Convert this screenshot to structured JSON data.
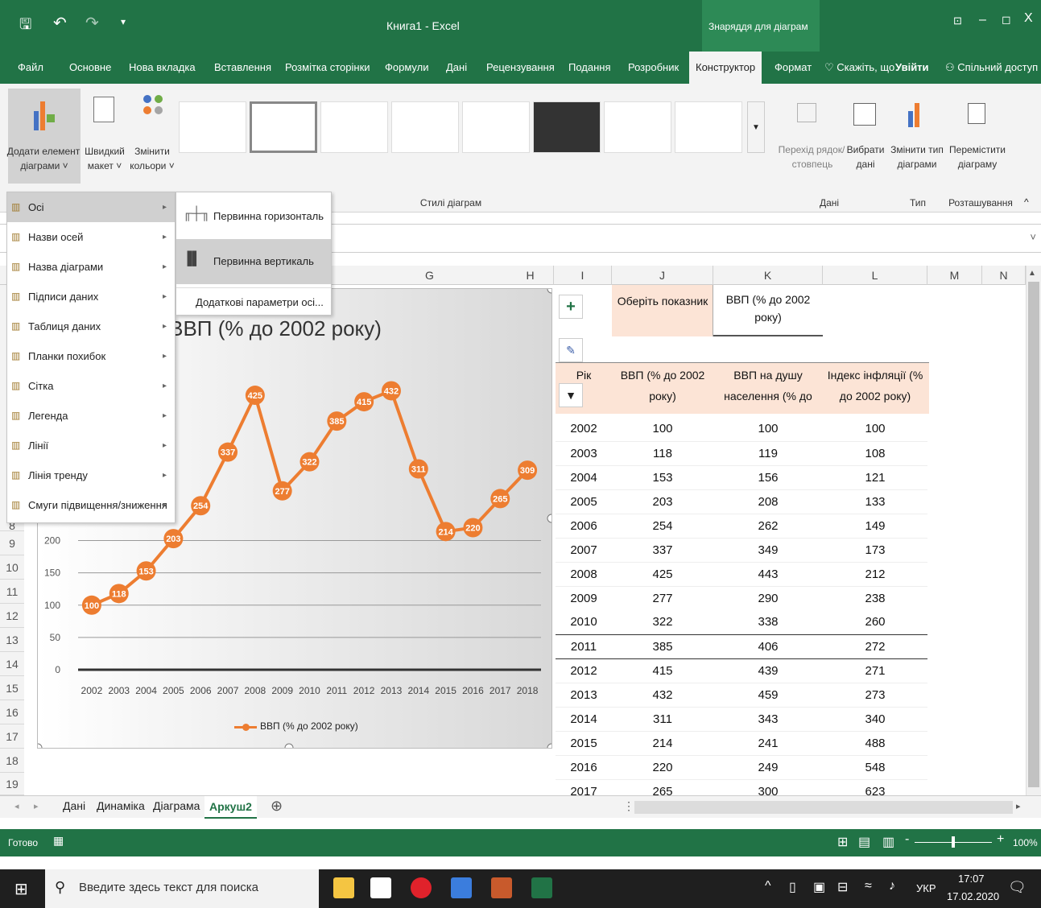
{
  "window": {
    "title": "Книга1 - Excel",
    "context_label": "Знаряддя для діаграм",
    "controls": [
      "▢",
      "–",
      "◻",
      "X"
    ]
  },
  "tabs": [
    "Файл",
    "Основне",
    "Нова вкладка",
    "Вставлення",
    "Розмітка сторінки",
    "Формули",
    "Дані",
    "Рецензування",
    "Подання",
    "Розробник",
    "Конструктор",
    "Формат"
  ],
  "tell_me": "Скажіть, що",
  "signin": "Увійти",
  "share": "Спільний доступ",
  "ribbon": {
    "add_element": [
      "Додати елемент",
      "діаграми ˅"
    ],
    "quick_layout": [
      "Швидкий",
      "макет ˅"
    ],
    "change_colors": [
      "Змінити",
      "кольори ˅"
    ],
    "styles_group": "Стилі діаграм",
    "switch_rowcol": [
      "Перехід рядок/",
      "стовпець"
    ],
    "select_data": [
      "Вибрати",
      "дані"
    ],
    "change_type": [
      "Змінити тип",
      "діаграми"
    ],
    "move_chart": [
      "Перемістити",
      "діаграму"
    ],
    "group_data": "Дані",
    "group_type": "Тип",
    "group_location": "Розташування"
  },
  "menu": {
    "items": [
      "Осі",
      "Назви осей",
      "Назва діаграми",
      "Підписи даних",
      "Таблиця даних",
      "Планки похибок",
      "Сітка",
      "Легенда",
      "Лінії",
      "Лінія тренду",
      "Смуги підвищення/зниження"
    ],
    "sub": [
      "Первинна горизонталь",
      "Первинна вертикаль",
      "Додаткові параметри осі..."
    ]
  },
  "columns": [
    "G",
    "H",
    "I",
    "J",
    "K",
    "L",
    "M",
    "N"
  ],
  "rows": [
    "8",
    "9",
    "10",
    "11",
    "12",
    "13",
    "14",
    "15",
    "16",
    "17",
    "18",
    "19"
  ],
  "sheet": {
    "select_label": "Оберіть показник",
    "select_value": [
      "ВВП (% до 2002",
      "року)"
    ],
    "headers": [
      [
        "Рік"
      ],
      [
        "ВВП (% до 2002",
        "року)"
      ],
      [
        "ВВП на душу",
        "населення (% до"
      ],
      [
        "Індекс інфляції (%",
        "до 2002 року)"
      ]
    ],
    "table": [
      [
        "2002",
        "100",
        "100",
        "100"
      ],
      [
        "2003",
        "118",
        "119",
        "108"
      ],
      [
        "2004",
        "153",
        "156",
        "121"
      ],
      [
        "2005",
        "203",
        "208",
        "133"
      ],
      [
        "2006",
        "254",
        "262",
        "149"
      ],
      [
        "2007",
        "337",
        "349",
        "173"
      ],
      [
        "2008",
        "425",
        "443",
        "212"
      ],
      [
        "2009",
        "277",
        "290",
        "238"
      ],
      [
        "2010",
        "322",
        "338",
        "260"
      ],
      [
        "2011",
        "385",
        "406",
        "272"
      ],
      [
        "2012",
        "415",
        "439",
        "271"
      ],
      [
        "2013",
        "432",
        "459",
        "273"
      ],
      [
        "2014",
        "311",
        "343",
        "340"
      ],
      [
        "2015",
        "214",
        "241",
        "488"
      ],
      [
        "2016",
        "220",
        "249",
        "548"
      ],
      [
        "2017",
        "265",
        "300",
        "623"
      ]
    ]
  },
  "chart_data": {
    "type": "line",
    "title": "ВВП (% до 2002 року)",
    "x": [
      "2002",
      "2003",
      "2004",
      "2005",
      "2006",
      "2007",
      "2008",
      "2009",
      "2010",
      "2011",
      "2012",
      "2013",
      "2014",
      "2015",
      "2016",
      "2017",
      "2018"
    ],
    "series": [
      {
        "name": "ВВП (% до 2002 року)",
        "values": [
          100,
          118,
          153,
          203,
          254,
          337,
          425,
          277,
          322,
          385,
          415,
          432,
          311,
          214,
          220,
          265,
          309
        ]
      }
    ],
    "yticks": [
      "0",
      "50",
      "100",
      "150",
      "200"
    ],
    "ylim": [
      0,
      450
    ],
    "color": "#ed7d31",
    "legend": "bottom",
    "grid": true
  },
  "sheet_tabs": [
    "Дані",
    "Динаміка",
    "Діаграма",
    "Аркуш2"
  ],
  "status": {
    "ready": "Готово",
    "zoom": "100%"
  },
  "taskbar": {
    "search": "Введите здесь текст для поиска",
    "lang": "УКР",
    "time": "17:07",
    "date": "17.02.2020"
  }
}
